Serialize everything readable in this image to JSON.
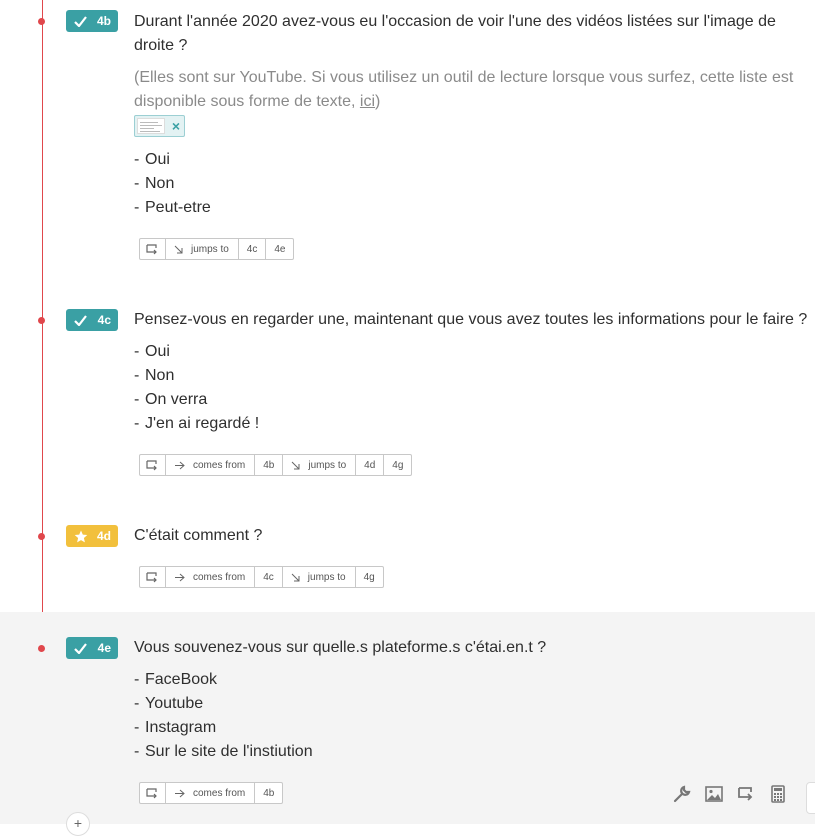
{
  "questions": [
    {
      "id": "4b",
      "type_icon": "check-icon",
      "title": "Durant l'année 2020 avez-vous eu l'occasion de voir l'une des vidéos listées sur l'image de droite ?",
      "hint": "(Elles sont sur YouTube. Si vous utilisez un outil de lecture lorsque vous surfez, cette liste est disponible sous forme de texte, ",
      "hint_link": "ici",
      "hint_end": ")",
      "options": [
        "Oui",
        "Non",
        "Peut-etre"
      ],
      "logic": {
        "jumps_to_label": "jumps to",
        "jumps_to": [
          "4c",
          "4e"
        ]
      }
    },
    {
      "id": "4c",
      "type_icon": "check-icon",
      "title": "Pensez-vous en regarder une, maintenant que vous avez toutes les informations pour le faire ?",
      "options": [
        "Oui",
        "Non",
        "On verra",
        "J'en ai regardé !"
      ],
      "logic": {
        "comes_from_label": "comes from",
        "comes_from": [
          "4b"
        ],
        "jumps_to_label": "jumps to",
        "jumps_to": [
          "4d",
          "4g"
        ]
      }
    },
    {
      "id": "4d",
      "type_icon": "star-icon",
      "title": "C'était comment ?",
      "logic": {
        "comes_from_label": "comes from",
        "comes_from": [
          "4c"
        ],
        "jumps_to_label": "jumps to",
        "jumps_to": [
          "4g"
        ]
      }
    },
    {
      "id": "4e",
      "type_icon": "check-icon",
      "title": "Vous souvenez-vous sur quelle.s plateforme.s c'étai.en.t ?",
      "options": [
        "FaceBook",
        "Youtube",
        "Instagram",
        "Sur le site de l'instiution"
      ],
      "logic": {
        "comes_from_label": "comes from",
        "comes_from": [
          "4b"
        ]
      }
    }
  ],
  "colors": {
    "accent_teal": "#3aa0a4",
    "accent_yellow": "#f2c03c",
    "timeline_red": "#e0474c"
  },
  "toolbar_icons": [
    "wrench-icon",
    "image-icon",
    "logic-icon",
    "calculator-icon"
  ]
}
